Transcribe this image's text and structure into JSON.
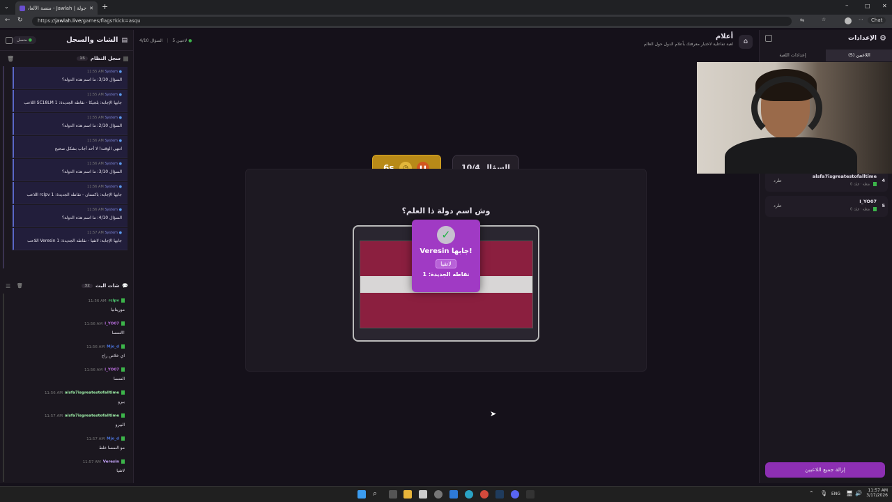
{
  "browser": {
    "tab_title": "جولة | Jawlah - منصة الألعاب التفا...",
    "url_prefix": "https://",
    "url_domain": "jawlah.live",
    "url_path": "/games/flags?kick=asqu",
    "chat_label": "Chat"
  },
  "left_panel": {
    "title": "الشات والسجل",
    "status": "متصل",
    "system_log": {
      "title": "سجل النظام",
      "count": "15",
      "entries": [
        {
          "sender": "System",
          "time": "11:55 AM",
          "text": "السؤال 3/10: ما اسم هذه الدولة؟"
        },
        {
          "sender": "System",
          "time": "11:55 AM",
          "text": "اللاعب SC18LM جابها الإجابة: بلجيكا - نقاطه الجديدة: 1"
        },
        {
          "sender": "System",
          "time": "11:55 AM",
          "text": "السؤال 2/10: ما اسم هذه الدولة؟"
        },
        {
          "sender": "System",
          "time": "11:56 AM",
          "text": "انتهى الوقت! لا أحد أجاب بشكل صحيح"
        },
        {
          "sender": "System",
          "time": "11:56 AM",
          "text": "السؤال 3/10: ما اسم هذه الدولة؟"
        },
        {
          "sender": "System",
          "time": "11:56 AM",
          "text": "اللاعب rclpv جابها الإجابة: باكستان - نقاطه الجديدة: 1"
        },
        {
          "sender": "System",
          "time": "11:56 AM",
          "text": "السؤال 4/10: ما اسم هذه الدولة؟"
        },
        {
          "sender": "System",
          "time": "11:57 AM",
          "text": "اللاعب Veresin جابها الإجابة: لاتفيا - نقاطه الجديدة: 1"
        }
      ]
    },
    "stream_chat": {
      "title": "شات البث",
      "count": "32",
      "messages": [
        {
          "user": "rclpv",
          "time": "11:56 AM",
          "text": "موريتانيا",
          "color": "#4ecb71"
        },
        {
          "user": "I_YO07",
          "time": "11:56 AM",
          "text": "النمسا!",
          "color": "#b36bd6"
        },
        {
          "user": "Mjo_d",
          "time": "11:56 AM",
          "text": "اي خلاص راح",
          "color": "#4a72d8"
        },
        {
          "user": "I_YO07",
          "time": "11:56 AM",
          "text": "النمسا",
          "color": "#b36bd6"
        },
        {
          "user": "alsfa7isgreatestofalltime",
          "time": "11:56 AM",
          "text": "بيرو",
          "color": "#9ef0a8"
        },
        {
          "user": "alsfa7isgreatestofalltime",
          "time": "11:57 AM",
          "text": "البيرو",
          "color": "#9ef0a8"
        },
        {
          "user": "Mjo_d",
          "time": "11:57 AM",
          "text": "مو النمسا غلط",
          "color": "#4a72d8"
        },
        {
          "user": "Veresin",
          "time": "11:57 AM",
          "text": "لاتفيا",
          "color": "#c9a8ff"
        }
      ]
    }
  },
  "header": {
    "players_online": "5 لاعبين",
    "question_indicator": "السؤال 4/10",
    "game_title": "أعلام",
    "game_subtitle": "لعبة تفاعلية لاختبار معرفتك بأعلام الدول حول العالم"
  },
  "game": {
    "timer": "6s",
    "question_badge": "السؤال 10/4",
    "question_text": "وش اسم دولة ذا العلم؟",
    "flag_colors": [
      "#8b1f3f",
      "#d8d6d6",
      "#8b1f3f"
    ],
    "winner_popup": {
      "title": "Veresin جابها!",
      "answer": "لاتفيا",
      "points": "نقاطه الجديدة: 1"
    }
  },
  "right_panel": {
    "title": "الإعدادات",
    "tabs": [
      "اللاعبين (5)",
      "إعدادات اللعبة"
    ],
    "players": [
      {
        "rank": "4",
        "name": "alsfa7isgreatestofalltime",
        "sub": "0 نقطة · فيك",
        "kick": "طرد"
      },
      {
        "rank": "5",
        "name": "I_YO07",
        "sub": "0 نقطة · فيك",
        "kick": "طرد"
      }
    ],
    "clear_button": "إزالة جميع اللاعبين"
  },
  "taskbar": {
    "lang": "ENG",
    "time": "11:57 AM",
    "date": "3/17/2026"
  }
}
